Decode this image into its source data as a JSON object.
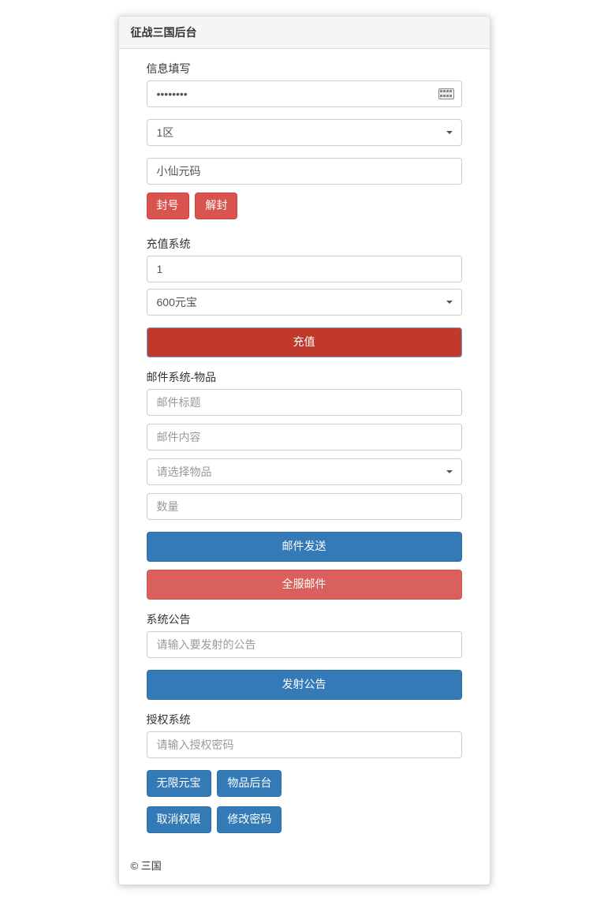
{
  "header": {
    "title": "征战三国后台"
  },
  "info": {
    "label": "信息填写",
    "password_value": "••••••••",
    "zone_selected": "1区",
    "nickname_value": "小仙元码",
    "ban_btn": "封号",
    "unban_btn": "解封"
  },
  "recharge": {
    "label": "充值系统",
    "qty_value": "1",
    "option_selected": "600元宝",
    "btn": "充值"
  },
  "mail": {
    "label": "邮件系统-物品",
    "title_placeholder": "邮件标题",
    "content_placeholder": "邮件内容",
    "item_placeholder": "请选择物品",
    "qty_placeholder": "数量",
    "send_btn": "邮件发送",
    "all_btn": "全服邮件"
  },
  "notice": {
    "label": "系统公告",
    "placeholder": "请输入要发射的公告",
    "btn": "发射公告"
  },
  "auth": {
    "label": "授权系统",
    "placeholder": "请输入授权密码",
    "btn_unlimited": "无限元宝",
    "btn_items": "物品后台",
    "btn_revoke": "取消权限",
    "btn_changepw": "修改密码"
  },
  "footer": {
    "copyright": "© 三国"
  }
}
